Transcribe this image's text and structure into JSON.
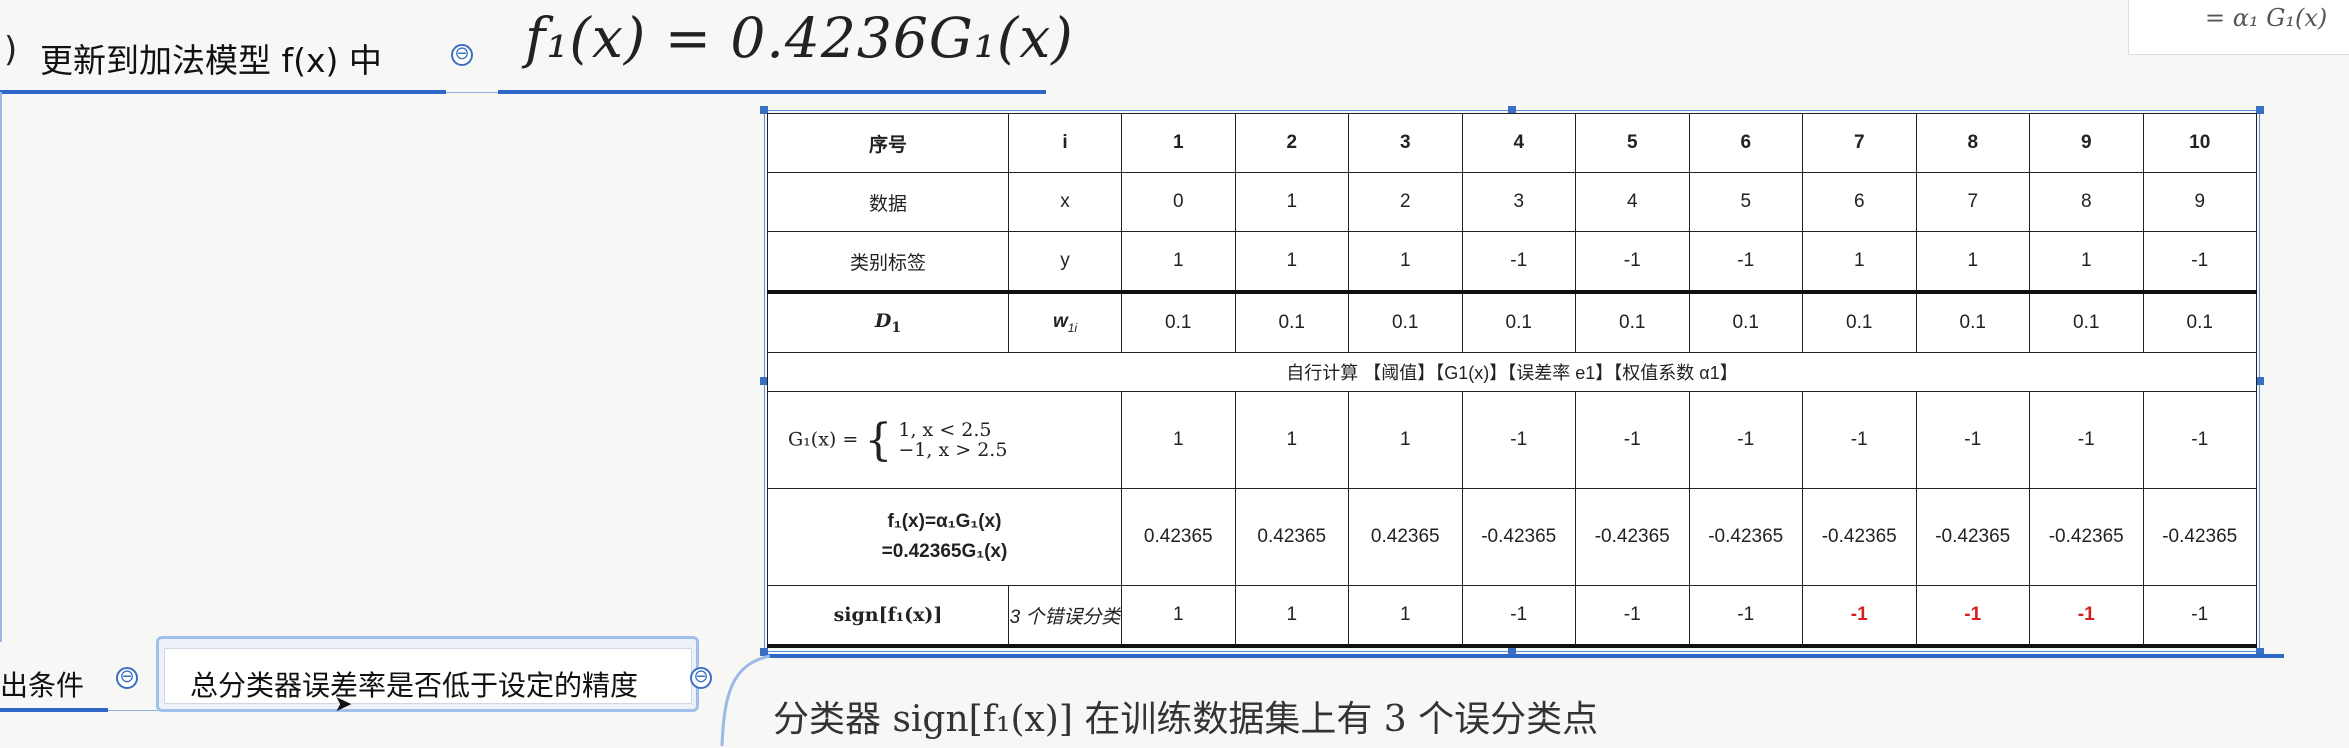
{
  "top_node": {
    "paren": ")",
    "title": "更新到加法模型 f(x) 中",
    "collapse_symbol": "⊖",
    "formula": "f₁(x) = 0.4236G₁(x)"
  },
  "corner_note": {
    "formula": "=  α₁ G₁(x)"
  },
  "table": {
    "header": {
      "label": "序号",
      "var": "i",
      "cols": [
        "1",
        "2",
        "3",
        "4",
        "5",
        "6",
        "7",
        "8",
        "9",
        "10"
      ]
    },
    "row_x": {
      "label": "数据",
      "var": "x",
      "values": [
        "0",
        "1",
        "2",
        "3",
        "4",
        "5",
        "6",
        "7",
        "8",
        "9"
      ]
    },
    "row_y": {
      "label": "类别标签",
      "var": "y",
      "values": [
        "1",
        "1",
        "1",
        "-1",
        "-1",
        "-1",
        "1",
        "1",
        "1",
        "-1"
      ]
    },
    "row_d": {
      "label": "D",
      "label_sub": "1",
      "var": "w",
      "var_sub": "1i",
      "values": [
        "0.1",
        "0.1",
        "0.1",
        "0.1",
        "0.1",
        "0.1",
        "0.1",
        "0.1",
        "0.1",
        "0.1"
      ]
    },
    "calc_note": "自行计算 【阈值】【G1(x)】【误差率 e1】【权值系数 α1】",
    "row_g": {
      "lhs": "G₁(x) =",
      "case1": "1,     x < 2.5",
      "case2": "−1,   x > 2.5",
      "values": [
        "1",
        "1",
        "1",
        "-1",
        "-1",
        "-1",
        "-1",
        "-1",
        "-1",
        "-1"
      ]
    },
    "row_f": {
      "line1": "f₁(x)=α₁G₁(x)",
      "line2": "=0.42365G₁(x)",
      "values": [
        "0.42365",
        "0.42365",
        "0.42365",
        "-0.42365",
        "-0.42365",
        "-0.42365",
        "-0.42365",
        "-0.42365",
        "-0.42365",
        "-0.42365"
      ]
    },
    "row_sign": {
      "label": "sign[f₁(x)]",
      "note": "3 个错误分类",
      "values": [
        "1",
        "1",
        "1",
        "-1",
        "-1",
        "-1",
        "-1",
        "-1",
        "-1",
        "-1"
      ],
      "misclassified": [
        false,
        false,
        false,
        false,
        false,
        false,
        true,
        true,
        true,
        false
      ]
    }
  },
  "bottom": {
    "left_text": "出条件",
    "collapse_symbol": "⊖",
    "node_text": "总分类器误差率是否低于设定的精度",
    "note": "分类器 sign[f₁(x)] 在训练数据集上有 3 个误分类点"
  },
  "colors": {
    "accent": "#2f67c8",
    "error": "#d62020"
  }
}
